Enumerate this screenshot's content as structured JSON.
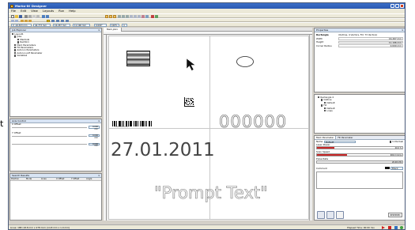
{
  "window": {
    "title": "Marks-It! Designer"
  },
  "menu": [
    "File",
    "Edit",
    "View",
    "Layouts",
    "Run",
    "Help"
  ],
  "toolbar": {
    "x_field": "X  -16.303 mm",
    "y_field": "44.773 mm",
    "w_field": "16.267 mm",
    "h_field": "11.196 mm",
    "angle_field": "0.000°",
    "scale_field": "100%",
    "count_field": "4"
  },
  "left_panel": {
    "title": "Job Explorer",
    "tree": [
      "Layout1",
      "Jobs",
      "Marklobi",
      "Rect0n1",
      "Mark Parameters",
      "Fill Parameters",
      "Autorun Parameters",
      "Autorun pdf Parameter",
      "Variables"
    ]
  },
  "axis_panel": {
    "title": "Axis Control",
    "x_label": "X Offset",
    "x_value": "0.000 mm",
    "y_label": "Y Offset",
    "y_value": "0.000 mm",
    "z_value": "0.000 mm"
  },
  "search_panel": {
    "title": "Search Results",
    "columns": [
      "Position",
      "Mode",
      "Lines",
      "X Offset",
      "Y Offset",
      "Angle"
    ]
  },
  "document_tab": "Mark.Job1",
  "canvas": {
    "barcode_digits": "0000000000000",
    "counter_text": "000000",
    "date_text": "27.01.2011",
    "prompt_text": "\"Prompt Text\""
  },
  "properties": {
    "title": "Properties",
    "object": "Rectangle",
    "object_desc": "(Outline, 4 Vectors, Fill: 73 Vectors)",
    "rows": [
      {
        "k": "Width",
        "v": "16.267 mm"
      },
      {
        "k": "Height",
        "v": "11.196 mm"
      },
      {
        "k": "Corner Radius",
        "v": "0.000 mm"
      }
    ]
  },
  "obj_tree": [
    "Rectangle 4",
    "Outline",
    "Default",
    "Fill",
    "Default",
    "Lines"
  ],
  "mark_params": {
    "title": "Mark Parameter",
    "tab": "Fill Parameter",
    "name_label": "Name",
    "name_value": "Default",
    "individual_label": "Individual",
    "laser_power_label": "Laser Power",
    "laser_power_value": "20.0 %",
    "laser_power_fraction": 0.2,
    "scan_speed_label": "Scan Speed",
    "scan_speed_value": "900.0 mm/s",
    "scan_speed_fraction": 0.35,
    "pulse_rate_label": "Pulse Rate",
    "pulse_rate_value": "20.00 kHz",
    "comment_label": "Comment",
    "color_label": "Black",
    "reserved_button": "RESERVED"
  },
  "statusbar": {
    "lines": "Lines: 188   (18.8 mm x 478 mm)   [14.8 mm x 1.0 mm]",
    "elapsed": "Elapsed Time: 00:00 min"
  },
  "side_text": "t",
  "colors": {
    "titlebar": "#2a58b0",
    "accent_red": "#c82828",
    "panel_header": "#d8e4f4"
  }
}
